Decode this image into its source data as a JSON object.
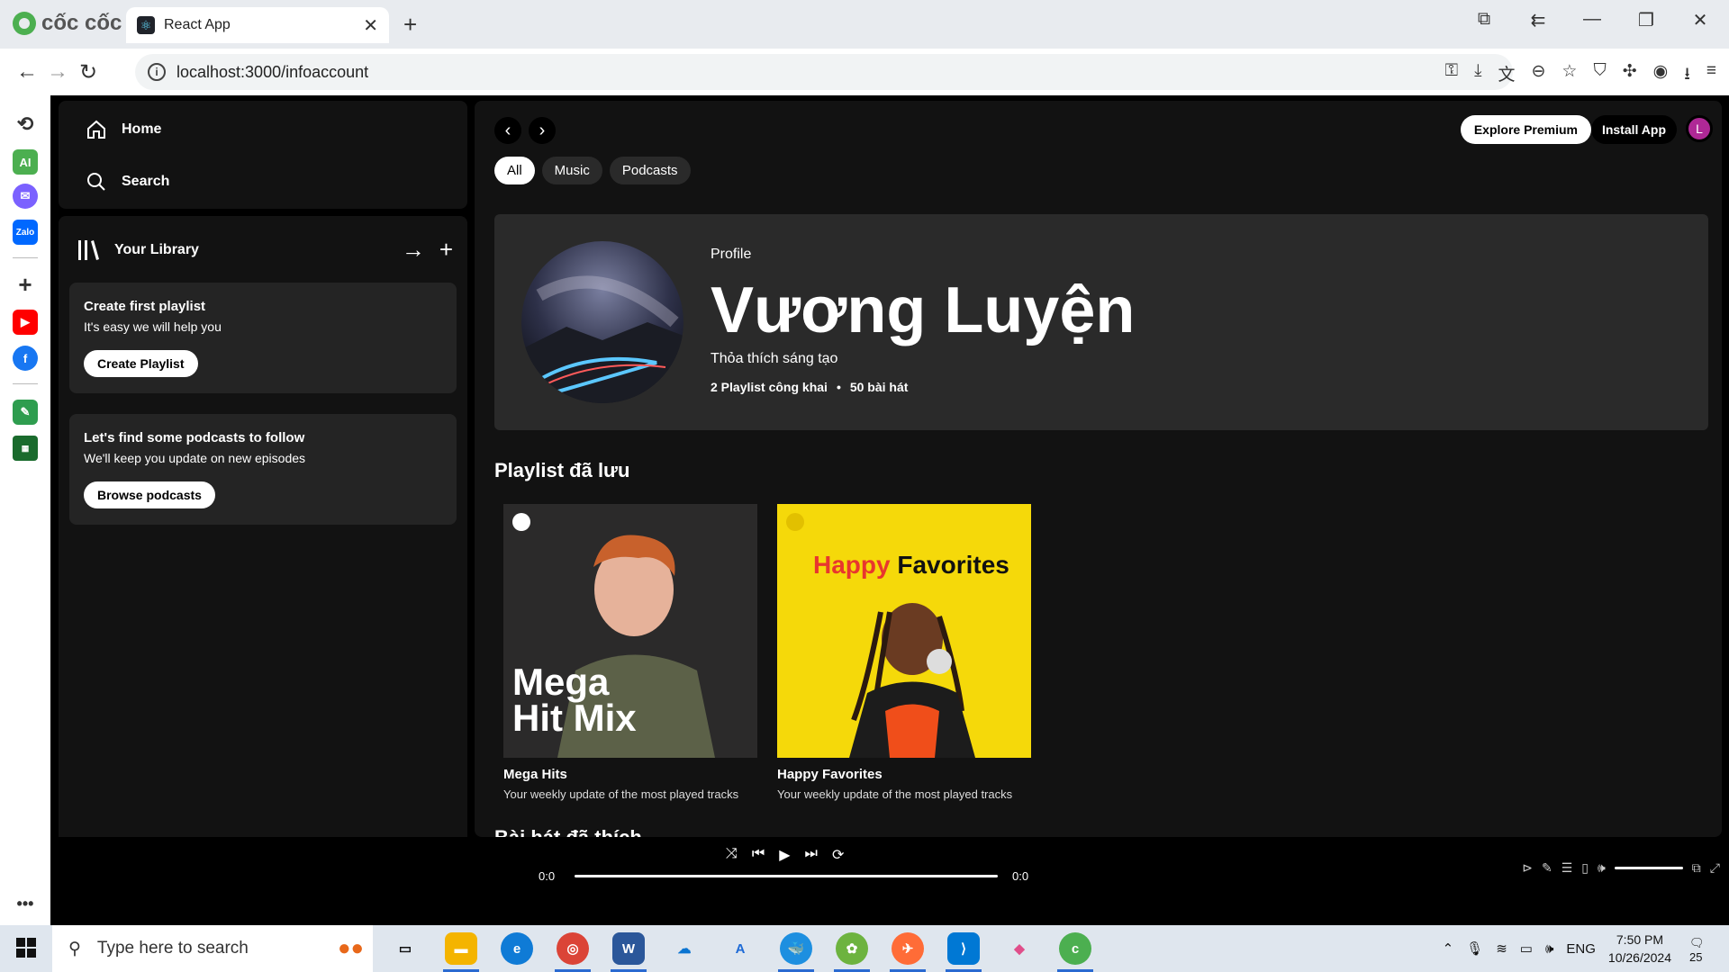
{
  "browser": {
    "brand": "cốc cốc",
    "tab_title": "React App",
    "url": "localhost:3000/infoaccount"
  },
  "nav": {
    "home": "Home",
    "search": "Search"
  },
  "library": {
    "title": "Your Library",
    "playlist_card": {
      "title": "Create first playlist",
      "text": "It's easy we will help you",
      "button": "Create Playlist"
    },
    "podcast_card": {
      "title": "Let's find some podcasts to follow",
      "text": "We'll keep you update on new episodes",
      "button": "Browse podcasts"
    }
  },
  "header": {
    "explore": "Explore Premium",
    "install": "Install App",
    "avatar_letter": "L",
    "chips": [
      "All",
      "Music",
      "Podcasts"
    ]
  },
  "profile": {
    "type": "Profile",
    "name": "Vương Luyện",
    "bio": "Thỏa thích sáng tạo",
    "playlists": "2 Playlist công khai",
    "songs": "50 bài hát"
  },
  "sections": {
    "saved": "Playlist đã lưu",
    "liked": "Bài hát đã thích"
  },
  "playlists": [
    {
      "name": "Mega Hits",
      "desc": "Your weekly update of the most played tracks",
      "cover_text_1": "Mega",
      "cover_text_2": "Hit Mix"
    },
    {
      "name": "Happy Favorites",
      "desc": "Your weekly update of the most played tracks",
      "cover_text_1": "Happy",
      "cover_text_2": "Favorites"
    }
  ],
  "player": {
    "elapsed": "0:0",
    "duration": "0:0",
    "progress": 0
  },
  "taskbar": {
    "search_placeholder": "Type here to search",
    "lang": "ENG",
    "time": "7:50 PM",
    "date": "10/26/2024",
    "notifications": "25"
  },
  "colors": {
    "accent_green": "#1db954",
    "happy_yellow": "#f5d90a"
  }
}
